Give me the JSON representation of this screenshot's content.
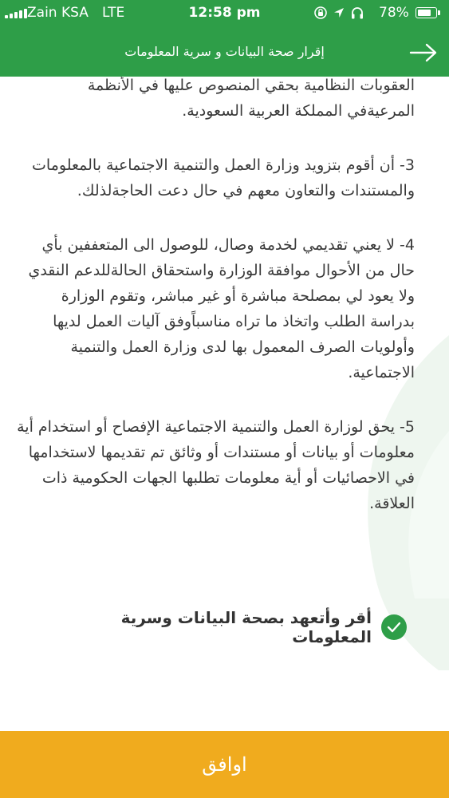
{
  "status_bar": {
    "carrier": "Zain KSA",
    "network": "LTE",
    "time": "12:58 pm",
    "battery": "78%",
    "battery_level": 0.78,
    "icons": [
      "signal-icon",
      "rotation-lock-icon",
      "location-icon",
      "headphones-icon",
      "battery-icon"
    ]
  },
  "nav": {
    "title": "إقرار صحة البيانات و سرية المعلومات",
    "back_icon": "arrow-right-icon"
  },
  "content": {
    "fragment": "العقوبات النظامية بحقي المنصوص عليها في الأنظمة المرعيةفي المملكة العربية السعودية.",
    "items": [
      "3- أن أقوم بتزويد وزارة العمل والتنمية الاجتماعية بالمعلومات والمستندات والتعاون معهم في حال دعت الحاجةلذلك.",
      "4- لا يعني تقديمي لخدمة وصال، للوصول الى المتعففين بأي حال من الأحوال موافقة الوزارة واستحقاق الحالةللدعم النقدي ولا يعود لي بمصلحة مباشرة أو غير مباشر، وتقوم الوزارة بدراسة الطلب واتخاذ ما تراه مناسباًوفق آليات العمل لديها وأولويات الصرف المعمول بها لدى وزارة العمل والتنمية الاجتماعية.",
      "5- يحق لوزارة العمل والتنمية الاجتماعية الإفصاح أو استخدام أية معلومات أو بيانات أو مستندات أو وثائق تم تقديمها لاستخدامها في الاحصائيات أو أية معلومات تطلبها الجهات الحكومية ذات العلاقة."
    ]
  },
  "acknowledgement": {
    "label": "أقر وأتعهد بصحة البيانات وسرية المعلومات",
    "checked": true,
    "icon": "check-circle-icon"
  },
  "footer": {
    "agree_label": "اوافق"
  },
  "colors": {
    "header": "#2e9e48",
    "accent_button": "#f0ab1e",
    "text": "#3a3a3a"
  }
}
